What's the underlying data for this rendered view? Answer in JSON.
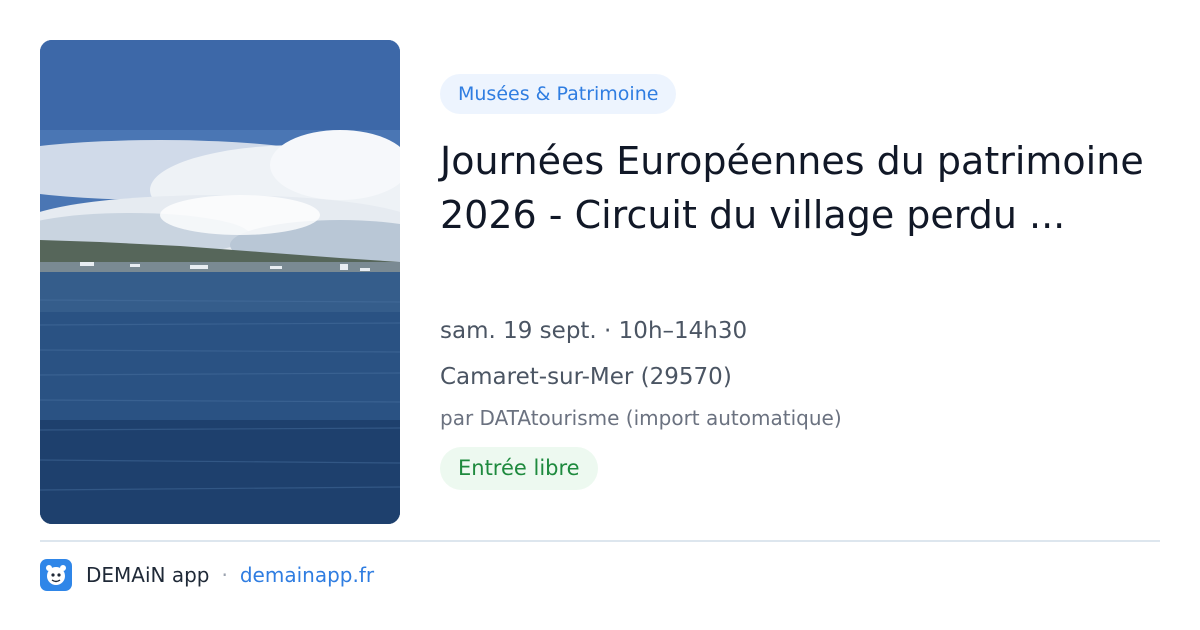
{
  "event": {
    "category": "Musées & Patrimoine",
    "title": "Journées Européennes du patrimoine 2026 - Circuit du village perdu ...",
    "date_time": "sam. 19 sept. · 10h–14h30",
    "location": "Camaret-sur-Mer (29570)",
    "source": "par DATAtourisme (import automatique)",
    "price": "Entrée libre"
  },
  "footer": {
    "app_name": "DEMAiN app",
    "separator": "·",
    "domain": "demainapp.fr"
  },
  "icons": {
    "app_logo": "demain-app-logo-icon"
  },
  "colors": {
    "accent_blue": "#2f7de1",
    "category_chip_bg": "#edf4fe",
    "price_green": "#1e8a3e",
    "price_chip_bg": "#edf9f0",
    "title_text": "#111827",
    "secondary_text": "#4b5563"
  }
}
